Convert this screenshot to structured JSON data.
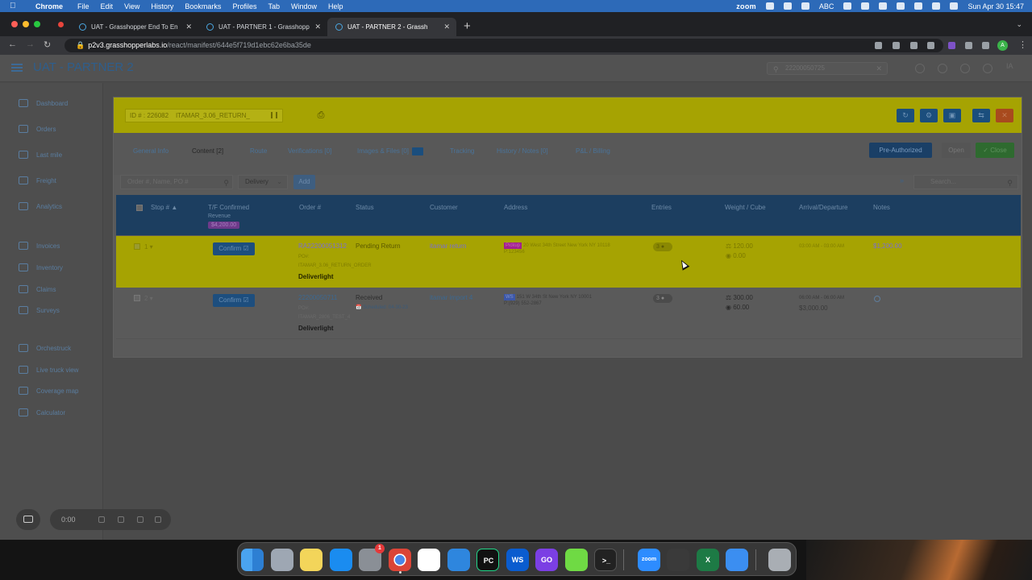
{
  "menubar": {
    "app": "Chrome",
    "items": [
      "File",
      "Edit",
      "View",
      "History",
      "Bookmarks",
      "Profiles",
      "Tab",
      "Window",
      "Help"
    ],
    "zoom_label": "zoom",
    "input_label": "ABC",
    "clock": "Sun Apr 30  15:47"
  },
  "browser": {
    "tabs": [
      {
        "title": "UAT - Grasshopper End To En"
      },
      {
        "title": "UAT - PARTNER 1 - Grasshopp"
      },
      {
        "title": "UAT - PARTNER 2 - Grassh"
      }
    ],
    "url_host": "p2v3.grasshopperlabs.io",
    "url_path": "/react/manifest/644e5f719d1ebc62e6ba35de",
    "profile_initial": "A"
  },
  "app": {
    "title": "UAT - PARTNER 2",
    "global_search_value": "22200050725",
    "avatar": "IA",
    "sidebar": [
      {
        "label": "Dashboard"
      },
      {
        "label": "Orders"
      },
      {
        "label": "Last mile"
      },
      {
        "label": "Freight"
      },
      {
        "label": "Analytics"
      },
      {
        "label": "Invoices"
      },
      {
        "label": "Inventory"
      },
      {
        "label": "Claims"
      },
      {
        "label": "Surveys"
      },
      {
        "label": "Orchestruck"
      },
      {
        "label": "Live truck view"
      },
      {
        "label": "Coverage map"
      },
      {
        "label": "Calculator"
      }
    ],
    "recorder_time": "0:00"
  },
  "modal": {
    "id_text": "ID # : 226082",
    "id_name": "ITAMAR_3.06_RETURN_",
    "tabs": [
      {
        "label": "General Info"
      },
      {
        "label": "Content [2]"
      },
      {
        "label": "Route"
      },
      {
        "label": "Verifications [0]"
      },
      {
        "label": "Images & Files [0]"
      },
      {
        "label": "Tracking"
      },
      {
        "label": "History / Notes [0]"
      },
      {
        "label": "P&L / Billing"
      }
    ],
    "preauth_label": "Pre-Authorized",
    "status_label": "Open",
    "close_label": "Close",
    "order_search_placeholder": "Order #, Name, PO #",
    "delivery_value": "Delivery",
    "add_label": "Add",
    "search_placeholder": "Search...",
    "columns": {
      "stop": "Stop #",
      "tf": "T/F Confirmed",
      "tf_sub": "Revenue",
      "tf_total": "$4,200.00",
      "order": "Order #",
      "status": "Status",
      "customer": "Customer",
      "address": "Address",
      "entries": "Entries",
      "weight": "Weight / Cube",
      "arrival": "Arrival/Departure",
      "notes": "Notes"
    },
    "rows": [
      {
        "stop": "1",
        "confirm": "Confirm",
        "order": "RA22200051312",
        "po": "PO#:",
        "ref": "ITAMAR_3.06_RETURN_ORDER",
        "service": "Deliverlight",
        "status": "Pending Return",
        "customer": "itamar return",
        "addr_tag": "Pickup",
        "address": "20 West 34th Street New York NY 10118",
        "phone": "P:123456",
        "entries": "3",
        "weight": "120.00",
        "cube": "0.00",
        "arrival": "03:00 AM - 03:00 AM",
        "notes": "$1,200.00"
      },
      {
        "stop": "2",
        "confirm": "Confirm",
        "order": "22200050711",
        "po": "PO#:",
        "ref": "ITAMAR_2806_TEST_4",
        "service": "Deliverlight",
        "status": "Received",
        "status_sub": "Scheduled: 04-30-23",
        "customer": "itamar import 4",
        "addr_tag": "WS",
        "address": "151 W 34th St New York NY 10001",
        "phone": "P:(929) 552-2867",
        "entries": "3",
        "weight": "300.00",
        "cube": "60.00",
        "arrival": "06:00 AM - 06:00 AM",
        "notes": "$3,000.00"
      }
    ]
  },
  "dock": {
    "apps": [
      "finder-icon",
      "launchpad-icon",
      "notes-icon",
      "app-store-icon",
      "system-settings-icon",
      "chrome-icon",
      "slack-icon",
      "maps-icon",
      "pycharm-icon",
      "webstorm-icon",
      "goland-icon",
      "upwork-icon",
      "terminal-icon",
      "zoom-icon",
      "sublime-icon",
      "excel-icon",
      "mail-icon",
      "trash-icon"
    ],
    "labels": {
      "pycharm": "PC",
      "webstorm": "WS",
      "goland": "GO",
      "zoom": "zoom",
      "excel": "X",
      "terminal": ">_"
    },
    "badge": "1"
  }
}
